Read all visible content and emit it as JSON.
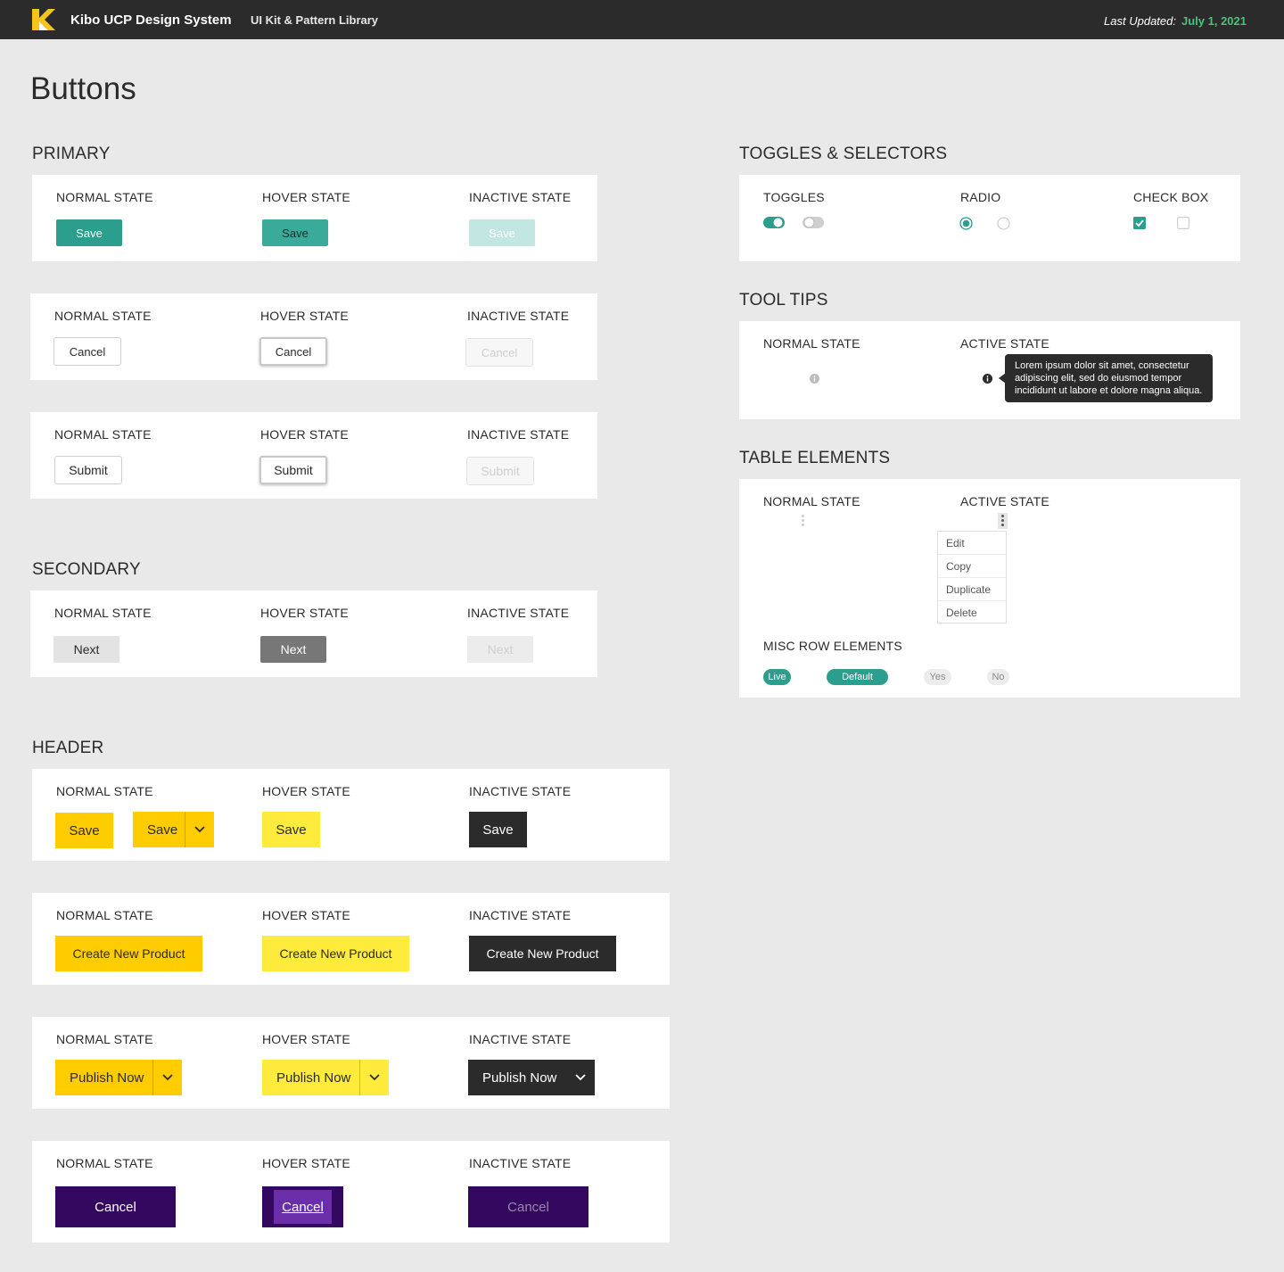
{
  "header": {
    "brand": "Kibo UCP Design System",
    "subtitle": "UI Kit & Pattern Library",
    "updated_label": "Last Updated:",
    "updated_date": "July 1, 2021"
  },
  "page_title": "Buttons",
  "states": {
    "normal": "NORMAL STATE",
    "hover": "HOVER STATE",
    "inactive": "INACTIVE STATE",
    "active": "ACTIVE STATE"
  },
  "primary": {
    "title": "PRIMARY",
    "save": "Save",
    "cancel": "Cancel",
    "submit": "Submit"
  },
  "secondary": {
    "title": "SECONDARY",
    "next": "Next"
  },
  "header_buttons": {
    "title": "HEADER",
    "save": "Save",
    "create": "Create New Product",
    "publish": "Publish Now",
    "cancel": "Cancel"
  },
  "toggles": {
    "title": "TOGGLES & SELECTORS",
    "toggles_label": "TOGGLES",
    "radio_label": "RADIO",
    "checkbox_label": "CHECK BOX"
  },
  "tooltips": {
    "title": "TOOL TIPS",
    "text": "Lorem ipsum dolor sit amet, consectetur adipiscing elit, sed do eiusmod tempor incididunt ut labore et dolore magna aliqua."
  },
  "table": {
    "title": "TABLE ELEMENTS",
    "menu": [
      "Edit",
      "Copy",
      "Duplicate",
      "Delete"
    ],
    "misc_label": "MISC ROW ELEMENTS",
    "pills": [
      "Live",
      "Default",
      "Yes",
      "No"
    ]
  },
  "colors": {
    "teal": "#2b9e8e",
    "teal_hover": "#3aab9a",
    "teal_inactive": "#c2e6e1",
    "yellow": "#ffcc00",
    "yellow_hover": "#ffeb3b",
    "dark": "#2b2b2b",
    "purple": "#33085e",
    "purple_hover": "#6a2fa8",
    "green_date": "#4ec07a"
  }
}
